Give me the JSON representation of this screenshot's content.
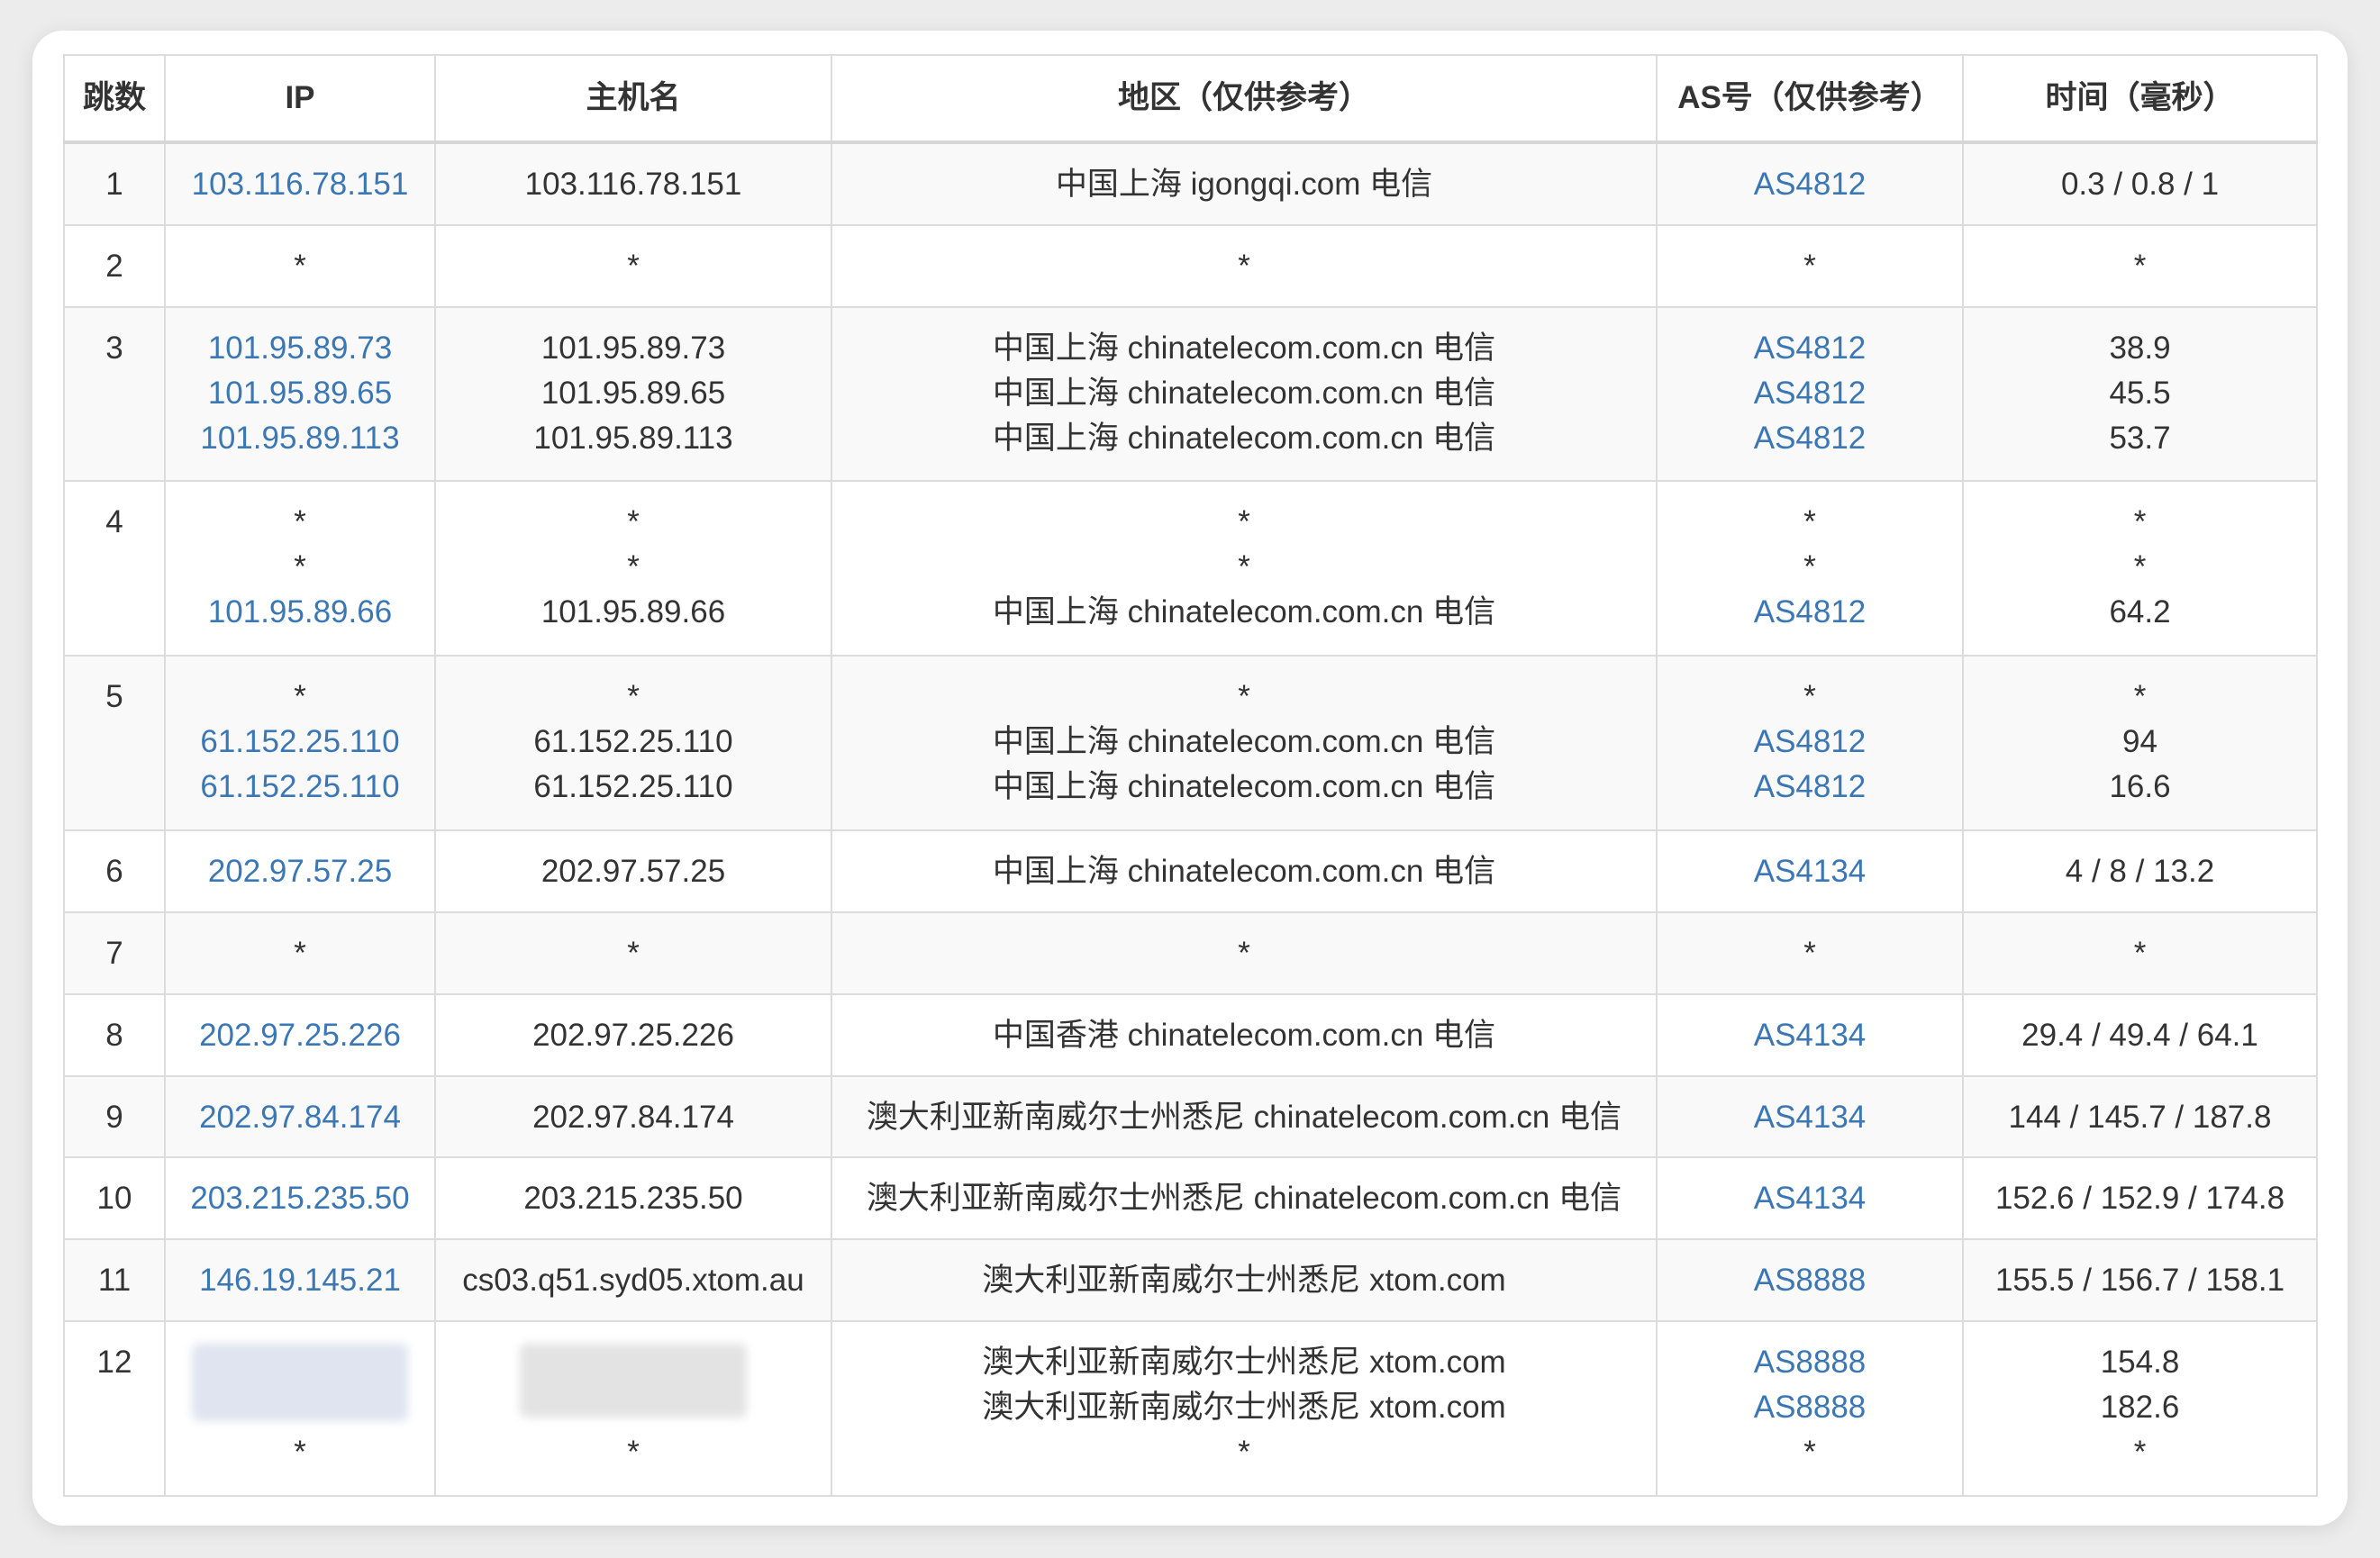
{
  "headers": {
    "hop": "跳数",
    "ip": "IP",
    "host": "主机名",
    "region": "地区（仅供参考）",
    "as": "AS号（仅供参考）",
    "time": "时间（毫秒）"
  },
  "rows": [
    {
      "hop": "1",
      "ip": [
        "103.116.78.151"
      ],
      "host": [
        "103.116.78.151"
      ],
      "region": [
        "中国上海 igongqi.com 电信"
      ],
      "as": [
        "AS4812"
      ],
      "time": [
        "0.3 / 0.8 / 1"
      ]
    },
    {
      "hop": "2",
      "ip": [
        "*"
      ],
      "host": [
        "*"
      ],
      "region": [
        "*"
      ],
      "as": [
        "*"
      ],
      "time": [
        "*"
      ]
    },
    {
      "hop": "3",
      "ip": [
        "101.95.89.73",
        "101.95.89.65",
        "101.95.89.113"
      ],
      "host": [
        "101.95.89.73",
        "101.95.89.65",
        "101.95.89.113"
      ],
      "region": [
        "中国上海 chinatelecom.com.cn 电信",
        "中国上海 chinatelecom.com.cn 电信",
        "中国上海 chinatelecom.com.cn 电信"
      ],
      "as": [
        "AS4812",
        "AS4812",
        "AS4812"
      ],
      "time": [
        "38.9",
        "45.5",
        "53.7"
      ]
    },
    {
      "hop": "4",
      "ip": [
        "*",
        "*",
        "101.95.89.66"
      ],
      "host": [
        "*",
        "*",
        "101.95.89.66"
      ],
      "region": [
        "*",
        "*",
        "中国上海 chinatelecom.com.cn 电信"
      ],
      "as": [
        "*",
        "*",
        "AS4812"
      ],
      "time": [
        "*",
        "*",
        "64.2"
      ]
    },
    {
      "hop": "5",
      "ip": [
        "*",
        "61.152.25.110",
        "61.152.25.110"
      ],
      "host": [
        "*",
        "61.152.25.110",
        "61.152.25.110"
      ],
      "region": [
        "*",
        "中国上海 chinatelecom.com.cn 电信",
        "中国上海 chinatelecom.com.cn 电信"
      ],
      "as": [
        "*",
        "AS4812",
        "AS4812"
      ],
      "time": [
        "*",
        "94",
        "16.6"
      ]
    },
    {
      "hop": "6",
      "ip": [
        "202.97.57.25"
      ],
      "host": [
        "202.97.57.25"
      ],
      "region": [
        "中国上海 chinatelecom.com.cn 电信"
      ],
      "as": [
        "AS4134"
      ],
      "time": [
        "4 / 8 / 13.2"
      ]
    },
    {
      "hop": "7",
      "ip": [
        "*"
      ],
      "host": [
        "*"
      ],
      "region": [
        "*"
      ],
      "as": [
        "*"
      ],
      "time": [
        "*"
      ]
    },
    {
      "hop": "8",
      "ip": [
        "202.97.25.226"
      ],
      "host": [
        "202.97.25.226"
      ],
      "region": [
        "中国香港 chinatelecom.com.cn 电信"
      ],
      "as": [
        "AS4134"
      ],
      "time": [
        "29.4 / 49.4 / 64.1"
      ]
    },
    {
      "hop": "9",
      "ip": [
        "202.97.84.174"
      ],
      "host": [
        "202.97.84.174"
      ],
      "region": [
        "澳大利亚新南威尔士州悉尼 chinatelecom.com.cn 电信"
      ],
      "as": [
        "AS4134"
      ],
      "time": [
        "144 / 145.7 / 187.8"
      ]
    },
    {
      "hop": "10",
      "ip": [
        "203.215.235.50"
      ],
      "host": [
        "203.215.235.50"
      ],
      "region": [
        "澳大利亚新南威尔士州悉尼 chinatelecom.com.cn 电信"
      ],
      "as": [
        "AS4134"
      ],
      "time": [
        "152.6 / 152.9 / 174.8"
      ]
    },
    {
      "hop": "11",
      "ip": [
        "146.19.145.21"
      ],
      "host": [
        "cs03.q51.syd05.xtom.au"
      ],
      "region": [
        "澳大利亚新南威尔士州悉尼 xtom.com"
      ],
      "as": [
        "AS8888"
      ],
      "time": [
        "155.5 / 156.7 / 158.1"
      ]
    },
    {
      "hop": "12",
      "ip": [
        "*"
      ],
      "host": [
        "*"
      ],
      "region": [
        "澳大利亚新南威尔士州悉尼 xtom.com",
        "澳大利亚新南威尔士州悉尼 xtom.com",
        "*"
      ],
      "as": [
        "AS8888",
        "AS8888",
        "*"
      ],
      "time": [
        "154.8",
        "182.6",
        "*"
      ]
    }
  ]
}
